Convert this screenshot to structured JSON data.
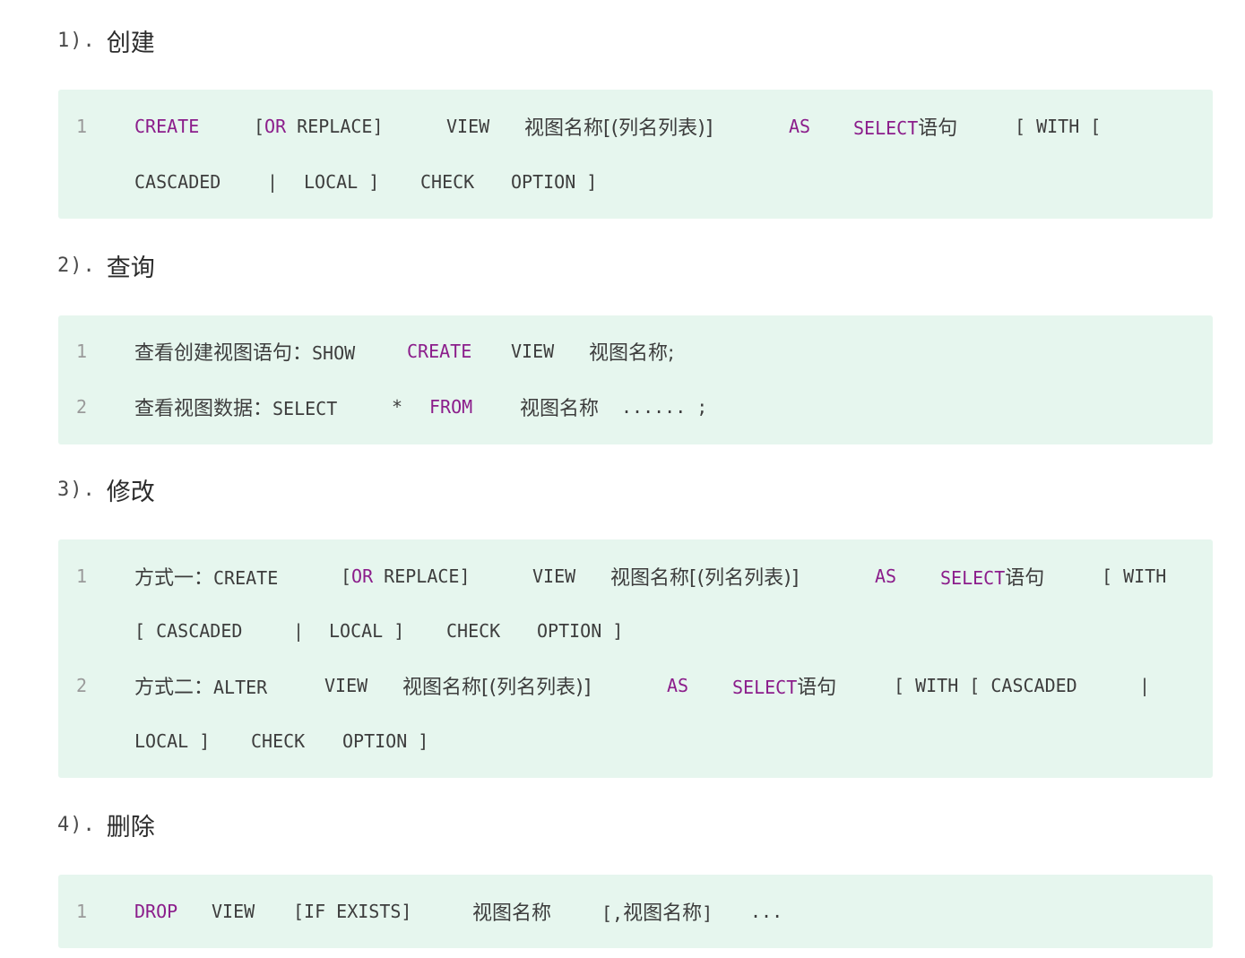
{
  "sections": [
    {
      "number": "1).",
      "title": "创建",
      "lines": [
        {
          "no": "1",
          "rows": [
            [
              "CREATE",
              "[OR REPLACE]",
              "VIEW",
              "视图名称[(列名列表)]",
              "AS",
              "SELECT语句",
              "[ WITH ["
            ],
            [
              "CASCADED",
              "|",
              "LOCAL ]",
              "CHECK",
              "OPTION ]"
            ]
          ]
        }
      ]
    },
    {
      "number": "2).",
      "title": "查询",
      "lines": [
        {
          "no": "1",
          "rows": [
            [
              "查看创建视图语句：SHOW",
              "CREATE",
              "VIEW",
              "视图名称;"
            ]
          ]
        },
        {
          "no": "2",
          "rows": [
            [
              "查看视图数据：SELECT",
              "*",
              "FROM",
              "视图名称",
              "...... ;"
            ]
          ]
        }
      ]
    },
    {
      "number": "3).",
      "title": "修改",
      "lines": [
        {
          "no": "1",
          "rows": [
            [
              "方式一：CREATE",
              "[OR REPLACE]",
              "VIEW",
              "视图名称[(列名列表)]",
              "AS",
              "SELECT语句",
              "[ WITH"
            ],
            [
              "[ CASCADED",
              "|",
              "LOCAL ]",
              "CHECK",
              "OPTION ]"
            ]
          ]
        },
        {
          "no": "2",
          "rows": [
            [
              "方式二：ALTER",
              "VIEW",
              "视图名称[(列名列表)]",
              "AS",
              "SELECT语句",
              "[ WITH [ CASCADED",
              "|"
            ],
            [
              "LOCAL ]",
              "CHECK",
              "OPTION ]"
            ]
          ]
        }
      ]
    },
    {
      "number": "4).",
      "title": "删除",
      "lines": [
        {
          "no": "1",
          "rows": [
            [
              "DROP",
              "VIEW",
              "[IF EXISTS]",
              "视图名称",
              "[,视图名称]",
              "..."
            ]
          ]
        }
      ]
    }
  ],
  "colors": {
    "code_background": "#e6f6ee",
    "keyword": "#8b1d8b",
    "text": "#3d3d3d",
    "line_number": "#9a9a9a"
  }
}
